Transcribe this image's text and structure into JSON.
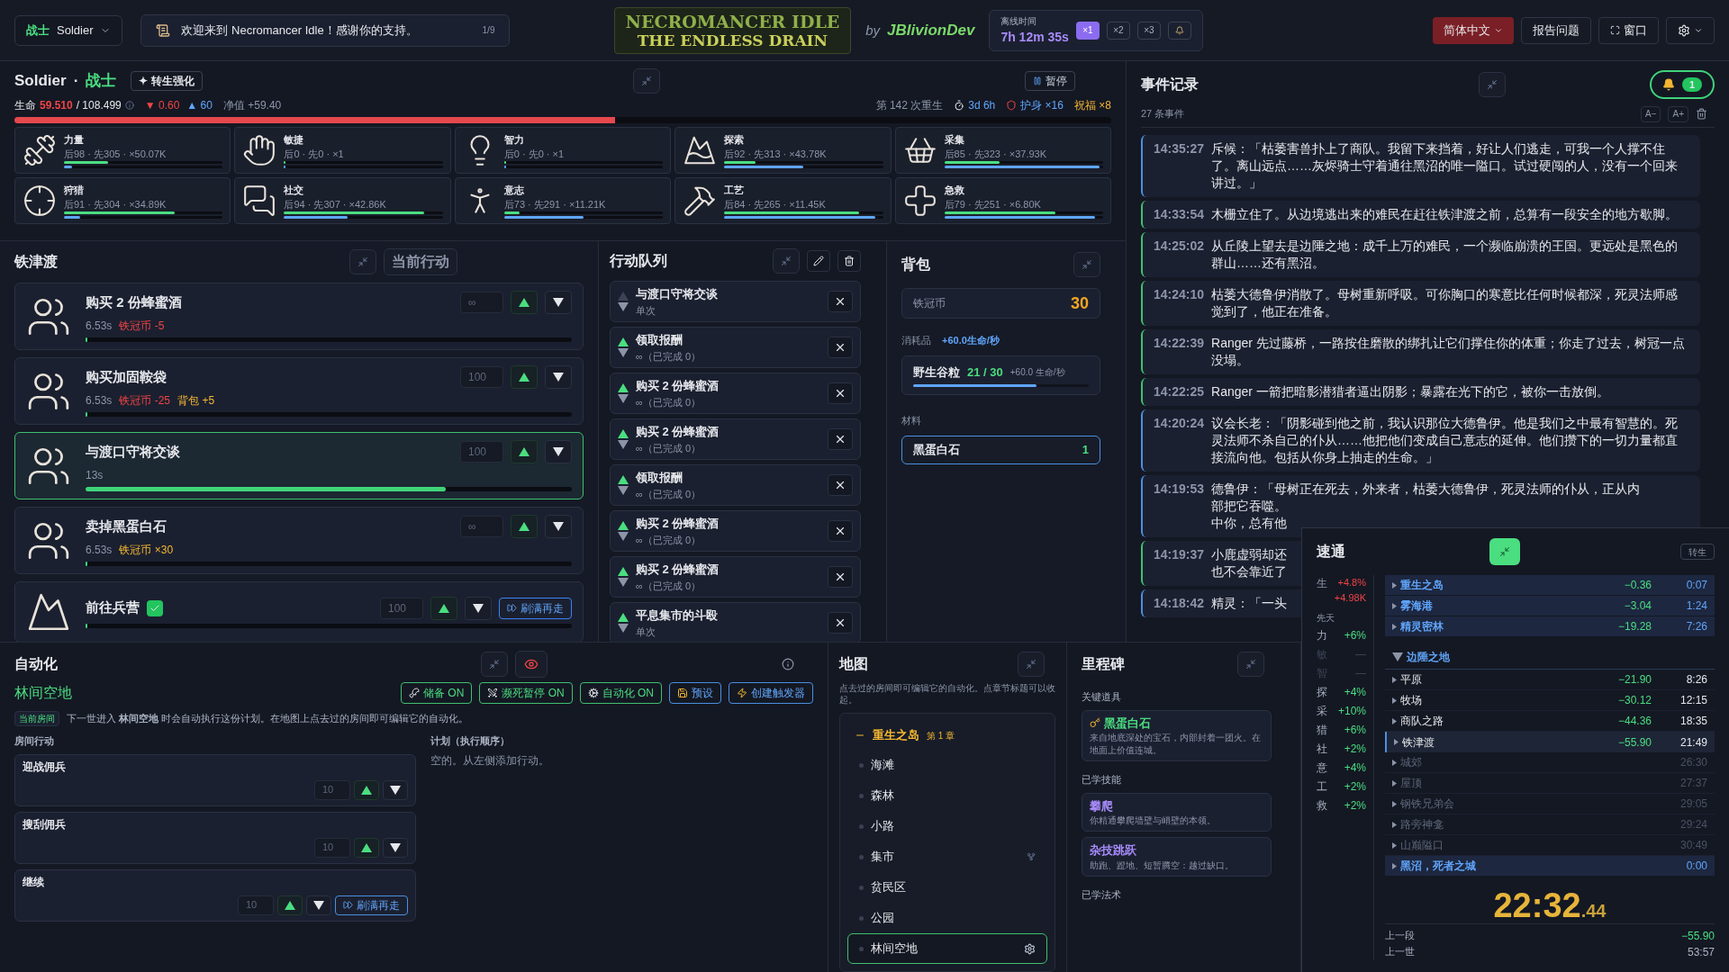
{
  "top_bar": {
    "class_selector": {
      "label": "战士",
      "value": "Soldier"
    },
    "announcement": {
      "text": "欢迎来到 Necromancer Idle！感谢你的支持。",
      "counter": "1/9"
    },
    "logo": {
      "line1": "NECROMANCER IDLE",
      "line2": "THE ENDLESS DRAIN"
    },
    "byline": {
      "by": "by",
      "author": "JBlivionDev"
    },
    "offline": {
      "label": "离线时间",
      "time": "7h 12m 35s",
      "speeds": [
        {
          "label": "×1",
          "selected": true
        },
        {
          "label": "×2",
          "selected": false
        },
        {
          "label": "×3",
          "selected": false
        }
      ]
    },
    "language": "简体中文",
    "report": "报告问题",
    "window": "窗口"
  },
  "character": {
    "name": "Soldier",
    "separator": "·",
    "class": "战士",
    "rebirth_button": "✦ 转生强化",
    "pause_button": "暂停",
    "life_label": "生命",
    "life_current": "59.510",
    "life_max": "/ 108.499",
    "drain": "▼ 0.60",
    "regen": "▲ 60",
    "net": "净值 +59.40",
    "rebirths": "第 142 次重生",
    "age": "3d 6h",
    "wards": "护身 ×16",
    "blessings": "祝福 ×8",
    "life_bar": {
      "level": 0.548
    }
  },
  "skills": [
    {
      "name": "力量",
      "stats": "后98 · 先305 · ×50.07K",
      "bars": [
        {
          "level": 0.28
        },
        {
          "level": 0.05
        }
      ]
    },
    {
      "name": "敏捷",
      "stats": "后0 · 先0 · ×1",
      "bars": [
        {
          "level": 0
        },
        {
          "level": 0
        }
      ]
    },
    {
      "name": "智力",
      "stats": "后0 · 先0 · ×1",
      "bars": [
        {
          "level": 0
        },
        {
          "level": 0
        }
      ]
    },
    {
      "name": "探索",
      "stats": "后92 · 先313 · ×43.78K",
      "bars": [
        {
          "level": 0.2
        },
        {
          "level": 0.5
        }
      ]
    },
    {
      "name": "采集",
      "stats": "后85 · 先323 · ×37.93K",
      "bars": [
        {
          "level": 0.35
        },
        {
          "level": 0.98
        }
      ]
    },
    {
      "name": "狩猎",
      "stats": "后91 · 先304 · ×34.89K",
      "bars": [
        {
          "level": 0.7
        },
        {
          "level": 0.1
        }
      ]
    },
    {
      "name": "社交",
      "stats": "后94 · 先307 · ×42.86K",
      "bars": [
        {
          "level": 0.88
        },
        {
          "level": 0.4
        }
      ]
    },
    {
      "name": "意志",
      "stats": "后73 · 先291 · ×11.21K",
      "bars": [
        {
          "level": 0.1
        },
        {
          "level": 0.5
        }
      ]
    },
    {
      "name": "工艺",
      "stats": "后84 · 先265 · ×11.45K",
      "bars": [
        {
          "level": 0.85
        },
        {
          "level": 0.95
        }
      ]
    },
    {
      "name": "急救",
      "stats": "后79 · 先251 · ×6.80K",
      "bars": [
        {
          "level": 0.7
        },
        {
          "level": 0.95
        }
      ]
    }
  ],
  "location": {
    "title": "铁津渡",
    "current_button": "当前行动",
    "actions": [
      {
        "kind": "talk",
        "name": "购买 2 份蜂蜜酒",
        "duration": "6.53s",
        "effects": [
          {
            "text": "铁冠币 -5",
            "kind": "cost"
          }
        ],
        "count": "∞",
        "level": 0,
        "selected": false
      },
      {
        "kind": "talk",
        "name": "购买加固鞍袋",
        "duration": "6.53s",
        "effects": [
          {
            "text": "铁冠币 -25",
            "kind": "cost"
          },
          {
            "text": "背包 +5",
            "kind": "gain"
          }
        ],
        "count": "100",
        "level": 0,
        "selected": false
      },
      {
        "kind": "talk",
        "name": "与渡口守将交谈",
        "duration": "13s",
        "count": "100",
        "level": 0.74,
        "selected": true
      },
      {
        "kind": "talk",
        "name": "卖掉黑蛋白石",
        "duration": "6.53s",
        "effects": [
          {
            "text": "铁冠币 ×30",
            "kind": "gain"
          }
        ],
        "count": "∞",
        "level": 0,
        "selected": false
      },
      {
        "kind": "travel",
        "name": "前往兵营",
        "done": true,
        "count": "100",
        "refill_button": "刷满再走",
        "level": 0,
        "selected": false
      }
    ]
  },
  "queue": {
    "title": "行动队列",
    "items": [
      {
        "name": "与渡口守将交谈",
        "detail": "单次"
      },
      {
        "name": "领取报酬",
        "detail": "∞（已完成 0）"
      },
      {
        "name": "购买 2 份蜂蜜酒",
        "detail": "∞（已完成 0）"
      },
      {
        "name": "购买 2 份蜂蜜酒",
        "detail": "∞（已完成 0）"
      },
      {
        "name": "领取报酬",
        "detail": "∞（已完成 0）"
      },
      {
        "name": "购买 2 份蜂蜜酒",
        "detail": "∞（已完成 0）"
      },
      {
        "name": "购买 2 份蜂蜜酒",
        "detail": "∞（已完成 0）"
      },
      {
        "name": "平息集市的斗殴",
        "detail": "单次"
      }
    ]
  },
  "backpack": {
    "title": "背包",
    "currency": {
      "name": "铁冠币",
      "amount": "30"
    },
    "consumables": {
      "label": "消耗品",
      "rate": "+60.0生命/秒",
      "items": [
        {
          "name": "野生谷粒",
          "count": "21 / 30",
          "effect": "+60.0 生命/秒",
          "level": 0.7
        }
      ]
    },
    "materials": {
      "label": "材料",
      "items": [
        {
          "name": "黑蛋白石",
          "count": "1",
          "selected": true
        }
      ]
    }
  },
  "event_log": {
    "title": "事件记录",
    "unread": "1",
    "count": "27 条事件",
    "font_down": "A−",
    "font_up": "A+",
    "entries": [
      {
        "time": "14:35:27",
        "color": "#4a8fe0",
        "lines": [
          "斥候：「枯萎害兽扑上了商队。我留下来挡着，好让人们逃走，可我一个人撑不住了。离山远点……灰烬骑士守着通往黑沼的唯一隘口。试过硬闯的人，没有一个回来讲过。」"
        ]
      },
      {
        "time": "14:33:54",
        "color": "#3fbf6f",
        "lines": [
          "木栅立住了。从边境逃出来的难民在赶往铁津渡之前，总算有一段安全的地方歇脚。"
        ]
      },
      {
        "time": "14:25:02",
        "color": "#3fbf6f",
        "lines": [
          "从丘陵上望去是边陲之地：成千上万的难民，一个濒临崩溃的王国。更远处是黑色的群山……还有黑沼。"
        ]
      },
      {
        "time": "14:24:10",
        "color": "#3fbf6f",
        "lines": [
          "枯萎大德鲁伊消散了。母树重新呼吸。可你胸口的寒意比任何时候都深，死灵法师感觉到了，他正在准备。"
        ]
      },
      {
        "time": "14:22:39",
        "color": "#3fbf6f",
        "lines": [
          "Ranger 先过藤桥，一路按住磨散的绑扎让它们撑住你的体重；你走了过去，树冠一点没塌。"
        ]
      },
      {
        "time": "14:22:25",
        "color": "#3fbf6f",
        "lines": [
          "Ranger 一箭把暗影潜猎者逼出阴影；暴露在光下的它，被你一击放倒。"
        ]
      },
      {
        "time": "14:20:24",
        "color": "#4a8fe0",
        "lines": [
          "议会长老：「阴影碰到他之前，我认识那位大德鲁伊。他是我们之中最有智慧的。死灵法师不杀自己的仆从……他把他们变成自己意志的延伸。他们攒下的一切力量都直接流向他。包括从你身上抽走的生命。」"
        ]
      },
      {
        "time": "14:19:53",
        "color": "#4a8fe0",
        "lines": [
          "德鲁伊：「母树正在死去，外来者，枯萎大德鲁伊，死灵法师的仆从，正从内",
          "部把它吞噬。",
          "中你，总有他"
        ]
      },
      {
        "time": "14:19:37",
        "color": "#3fbf6f",
        "lines": [
          "小鹿虚弱却还",
          "也不会靠近了"
        ]
      },
      {
        "time": "14:18:42",
        "color": "#4a8fe0",
        "lines": [
          "精灵：「一头"
        ]
      }
    ]
  },
  "automation": {
    "title": "自动化",
    "room": "林间空地",
    "toggles": [
      {
        "kind": "food",
        "label": "储备 ON",
        "on": true
      },
      {
        "kind": "death",
        "label": "濒死暂停 ON",
        "on": true
      },
      {
        "kind": "auto",
        "label": "自动化 ON",
        "on": true
      }
    ],
    "buttons": [
      {
        "kind": "preset",
        "label": "预设"
      },
      {
        "kind": "trigger",
        "label": "创建触发器"
      }
    ],
    "room_badge": "当前房间",
    "note": "下一世进入 **林间空地** 时会自动执行这份计划。在地图上点去过的房间即可编辑它的自动化。",
    "room_actions_label": "房间行动",
    "room_actions": [
      {
        "name": "迎战佣兵",
        "count": "10"
      },
      {
        "name": "搜刮佣兵",
        "count": "10"
      },
      {
        "name": "继续",
        "count": "10",
        "refill_button": "刷满再走"
      }
    ],
    "plan_label": "计划（执行顺序）",
    "plan_empty": "空的。从左侧添加行动。"
  },
  "map": {
    "title": "地图",
    "hint": "点去过的房间即可编辑它的自动化。点章节标题可以收起。",
    "chapters": [
      {
        "name": "重生之岛",
        "tag": "第 1 章",
        "expanded": true,
        "rooms": [
          {
            "name": "海滩",
            "selected": false
          },
          {
            "name": "森林",
            "selected": false
          },
          {
            "name": "小路",
            "selected": false
          },
          {
            "name": "集市",
            "selected": false,
            "branch": true
          },
          {
            "name": "贫民区",
            "selected": false
          },
          {
            "name": "公园",
            "selected": false
          },
          {
            "name": "林间空地",
            "selected": true
          }
        ]
      }
    ]
  },
  "milestones": {
    "title": "里程碑",
    "sections": [
      {
        "label": "关键道具",
        "kind": "items",
        "cards": [
          {
            "name": "黑蛋白石",
            "desc": "来自地底深处的宝石，内部封着一团火。在地面上价值连城。"
          }
        ]
      },
      {
        "label": "已学技能",
        "kind": "skills",
        "cards": [
          {
            "name": "攀爬",
            "desc": "你精通攀爬墙壁与峭壁的本领。"
          },
          {
            "name": "杂技跳跃",
            "desc": "助跑、蹬地、短暂腾空：越过缺口。"
          }
        ]
      },
      {
        "label": "已学法术"
      }
    ]
  },
  "speedrun": {
    "title": "速通",
    "rebirth": "转生",
    "bonus": {
      "label": "生",
      "values": [
        "+4.8%",
        "+4.98K"
      ]
    },
    "innate_label": "先天",
    "stats": [
      {
        "label": "力",
        "value": "+6%",
        "active": true
      },
      {
        "label": "敏",
        "value": "—",
        "active": false
      },
      {
        "label": "智",
        "value": "—",
        "active": false
      },
      {
        "label": "探",
        "value": "+4%",
        "active": true
      },
      {
        "label": "采",
        "value": "+10%",
        "active": true
      },
      {
        "label": "猎",
        "value": "+6%",
        "active": true
      },
      {
        "label": "社",
        "value": "+2%",
        "active": true
      },
      {
        "label": "意",
        "value": "+4%",
        "active": true
      },
      {
        "label": "工",
        "value": "+2%",
        "active": true
      },
      {
        "label": "救",
        "value": "+2%",
        "active": true
      }
    ],
    "splits": [
      {
        "kind": "chapter",
        "name": "重生之岛",
        "delta": "−0.36",
        "time": "0:07",
        "expanded": false
      },
      {
        "kind": "chapter",
        "name": "雾海港",
        "delta": "−3.04",
        "time": "1:24",
        "expanded": false
      },
      {
        "kind": "chapter",
        "name": "精灵密林",
        "delta": "−19.28",
        "time": "7:26",
        "expanded": false
      },
      {
        "kind": "chapter",
        "name": "边陲之地",
        "expanded": true
      },
      {
        "kind": "room",
        "name": "平原",
        "delta": "−21.90",
        "time": "8:26",
        "reached": true,
        "selected": false
      },
      {
        "kind": "room",
        "name": "牧场",
        "delta": "−30.12",
        "time": "12:15",
        "reached": true,
        "selected": false
      },
      {
        "kind": "room",
        "name": "商队之路",
        "delta": "−44.36",
        "time": "18:35",
        "reached": true,
        "selected": false
      },
      {
        "kind": "room",
        "name": "铁津渡",
        "delta": "−55.90",
        "time": "21:49",
        "reached": true,
        "selected": true
      },
      {
        "kind": "room",
        "name": "城郊",
        "time": "26:30",
        "reached": false,
        "selected": false
      },
      {
        "kind": "room",
        "name": "屋顶",
        "time": "27:37",
        "reached": false,
        "selected": false
      },
      {
        "kind": "room",
        "name": "钢铁兄弟会",
        "time": "29:05",
        "reached": false,
        "selected": false
      },
      {
        "kind": "room",
        "name": "路旁神龛",
        "time": "29:24",
        "reached": false,
        "selected": false
      },
      {
        "kind": "room",
        "name": "山巅隘口",
        "time": "30:49",
        "reached": false,
        "selected": false
      },
      {
        "kind": "chapter",
        "name": "黑沼，死者之城",
        "time": "0:00",
        "expanded": false
      }
    ],
    "timer": {
      "main": "22:32",
      "fraction": ".44"
    },
    "footer": [
      {
        "label": "上一段",
        "value": "−55.90",
        "kind": "delta"
      },
      {
        "label": "上一世",
        "value": "53:57",
        "kind": "time"
      }
    ]
  }
}
